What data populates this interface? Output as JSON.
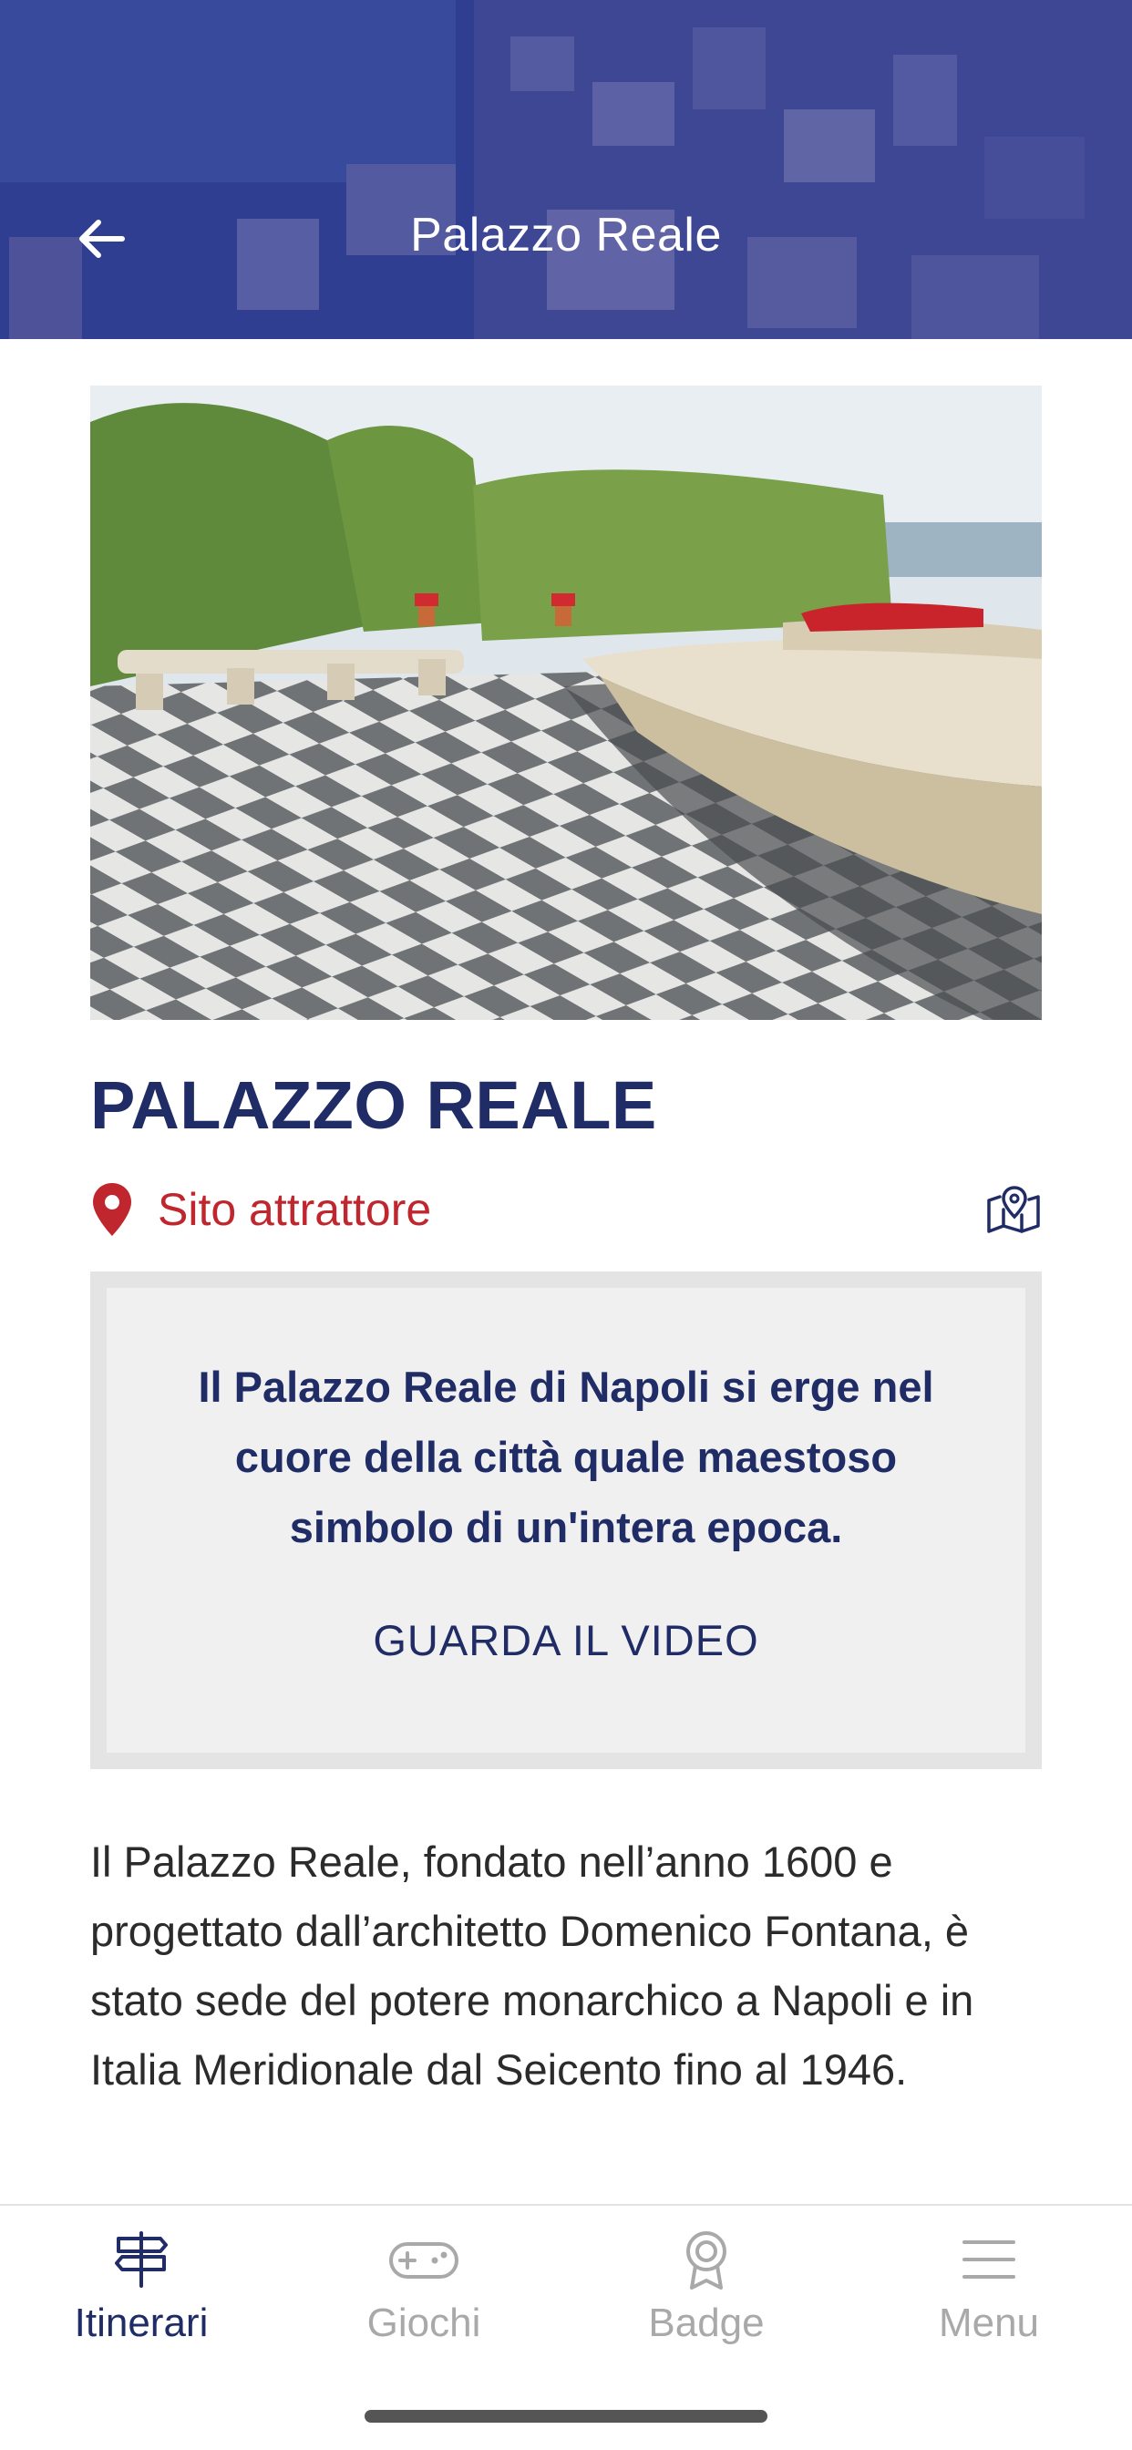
{
  "header": {
    "title": "Palazzo Reale",
    "back_icon": "arrow-left-icon"
  },
  "poi": {
    "photo_description": "garden-terrace-photo",
    "title": "PALAZZO REALE",
    "category_icon": "map-pin-icon",
    "category_label": "Sito attrattore",
    "map_icon": "map-icon",
    "highlight_text": "Il Palazzo Reale di Napoli si erge nel cuore della città quale maestoso simbolo di un'intera epoca.",
    "video_link": "GUARDA IL VIDEO",
    "description": "Il Palazzo Reale, fondato nell’anno 1600 e progettato dall’architetto Domenico Fontana, è stato sede del potere monarchico a Napoli e in Italia Meridionale dal Seicento fino al 1946."
  },
  "bottom_nav": {
    "items": [
      {
        "label": "Itinerari",
        "icon": "signpost-icon",
        "active": true
      },
      {
        "label": "Giochi",
        "icon": "gamepad-icon",
        "active": false
      },
      {
        "label": "Badge",
        "icon": "badge-icon",
        "active": false
      },
      {
        "label": "Menu",
        "icon": "menu-icon",
        "active": false
      }
    ]
  },
  "colors": {
    "primary": "#1f2c66",
    "accent_red": "#c0262d",
    "inactive": "#a9a9a9",
    "header_overlay": "#2f3a8c"
  }
}
